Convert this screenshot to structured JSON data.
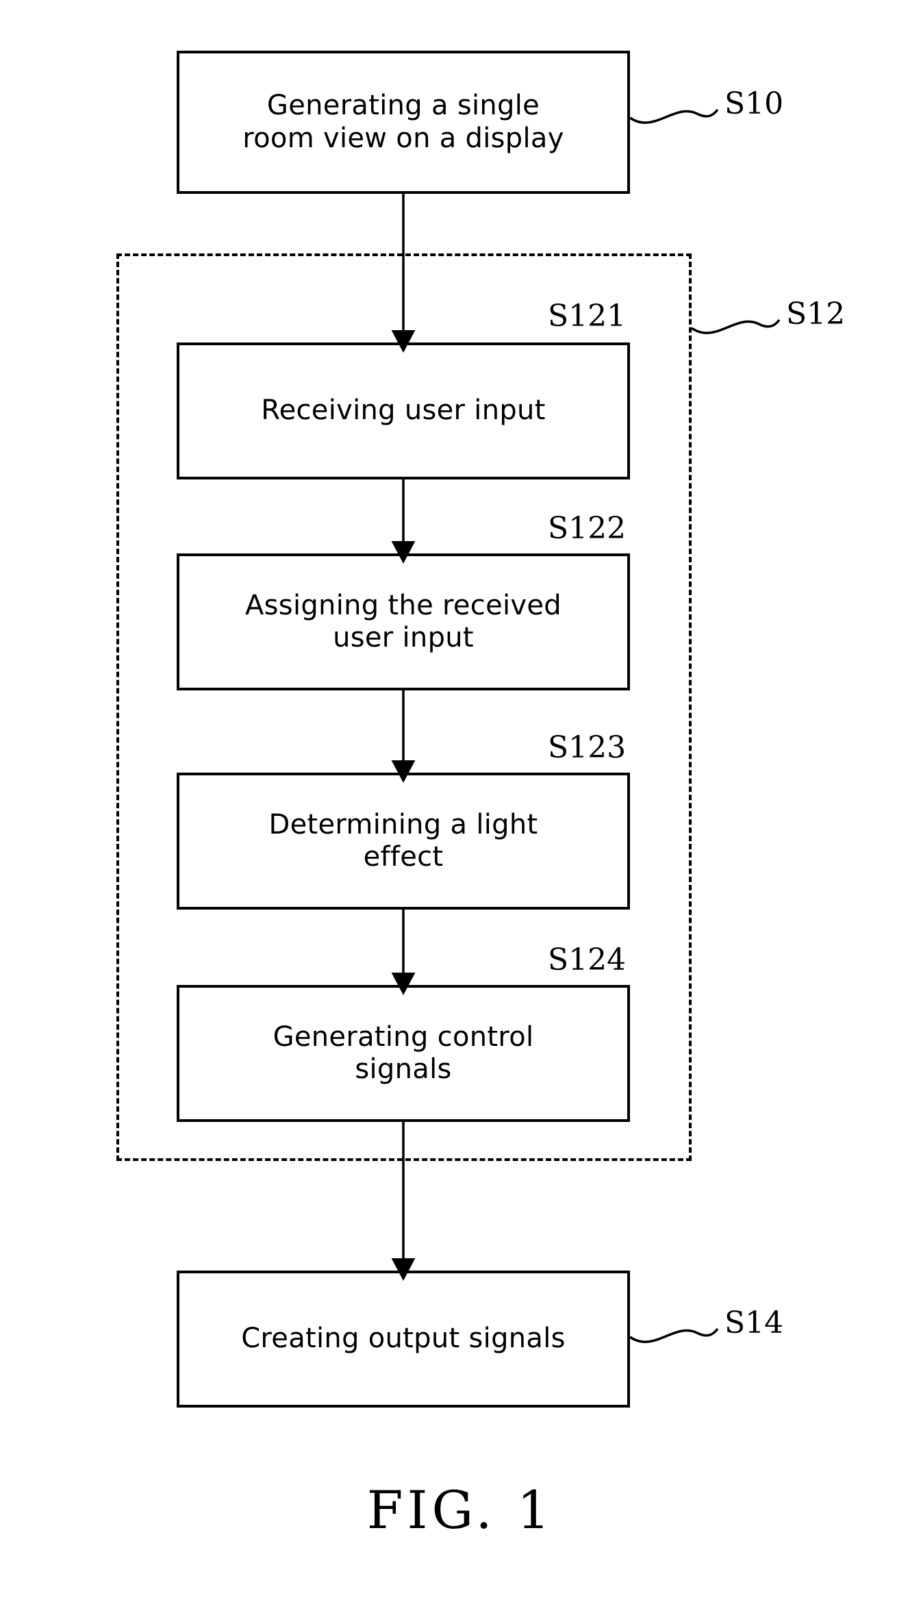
{
  "figure": {
    "caption": "FIG. 1",
    "type": "patent-flowchart",
    "background_color": "#ffffff",
    "line_color": "#000000"
  },
  "group": {
    "ref": "S12",
    "style": "dashed",
    "contains": [
      "S121",
      "S122",
      "S123",
      "S124"
    ]
  },
  "steps": [
    {
      "ref": "S10",
      "label": "Generating a single\nroom view on a display",
      "ref_position": "right-outside"
    },
    {
      "ref": "S121",
      "label": "Receiving user input",
      "ref_position": "above-right"
    },
    {
      "ref": "S122",
      "label": "Assigning the received\nuser input",
      "ref_position": "above-right"
    },
    {
      "ref": "S123",
      "label": "Determining a light\neffect",
      "ref_position": "above-right"
    },
    {
      "ref": "S124",
      "label": "Generating control\nsignals",
      "ref_position": "above-right"
    },
    {
      "ref": "S14",
      "label": "Creating output signals",
      "ref_position": "right-outside"
    }
  ],
  "flow": [
    {
      "from": "S10",
      "to": "S121",
      "arrow": "filled-triangle"
    },
    {
      "from": "S121",
      "to": "S122",
      "arrow": "filled-triangle"
    },
    {
      "from": "S122",
      "to": "S123",
      "arrow": "filled-triangle"
    },
    {
      "from": "S123",
      "to": "S124",
      "arrow": "filled-triangle"
    },
    {
      "from": "S124",
      "to": "S14",
      "arrow": "filled-triangle"
    }
  ]
}
